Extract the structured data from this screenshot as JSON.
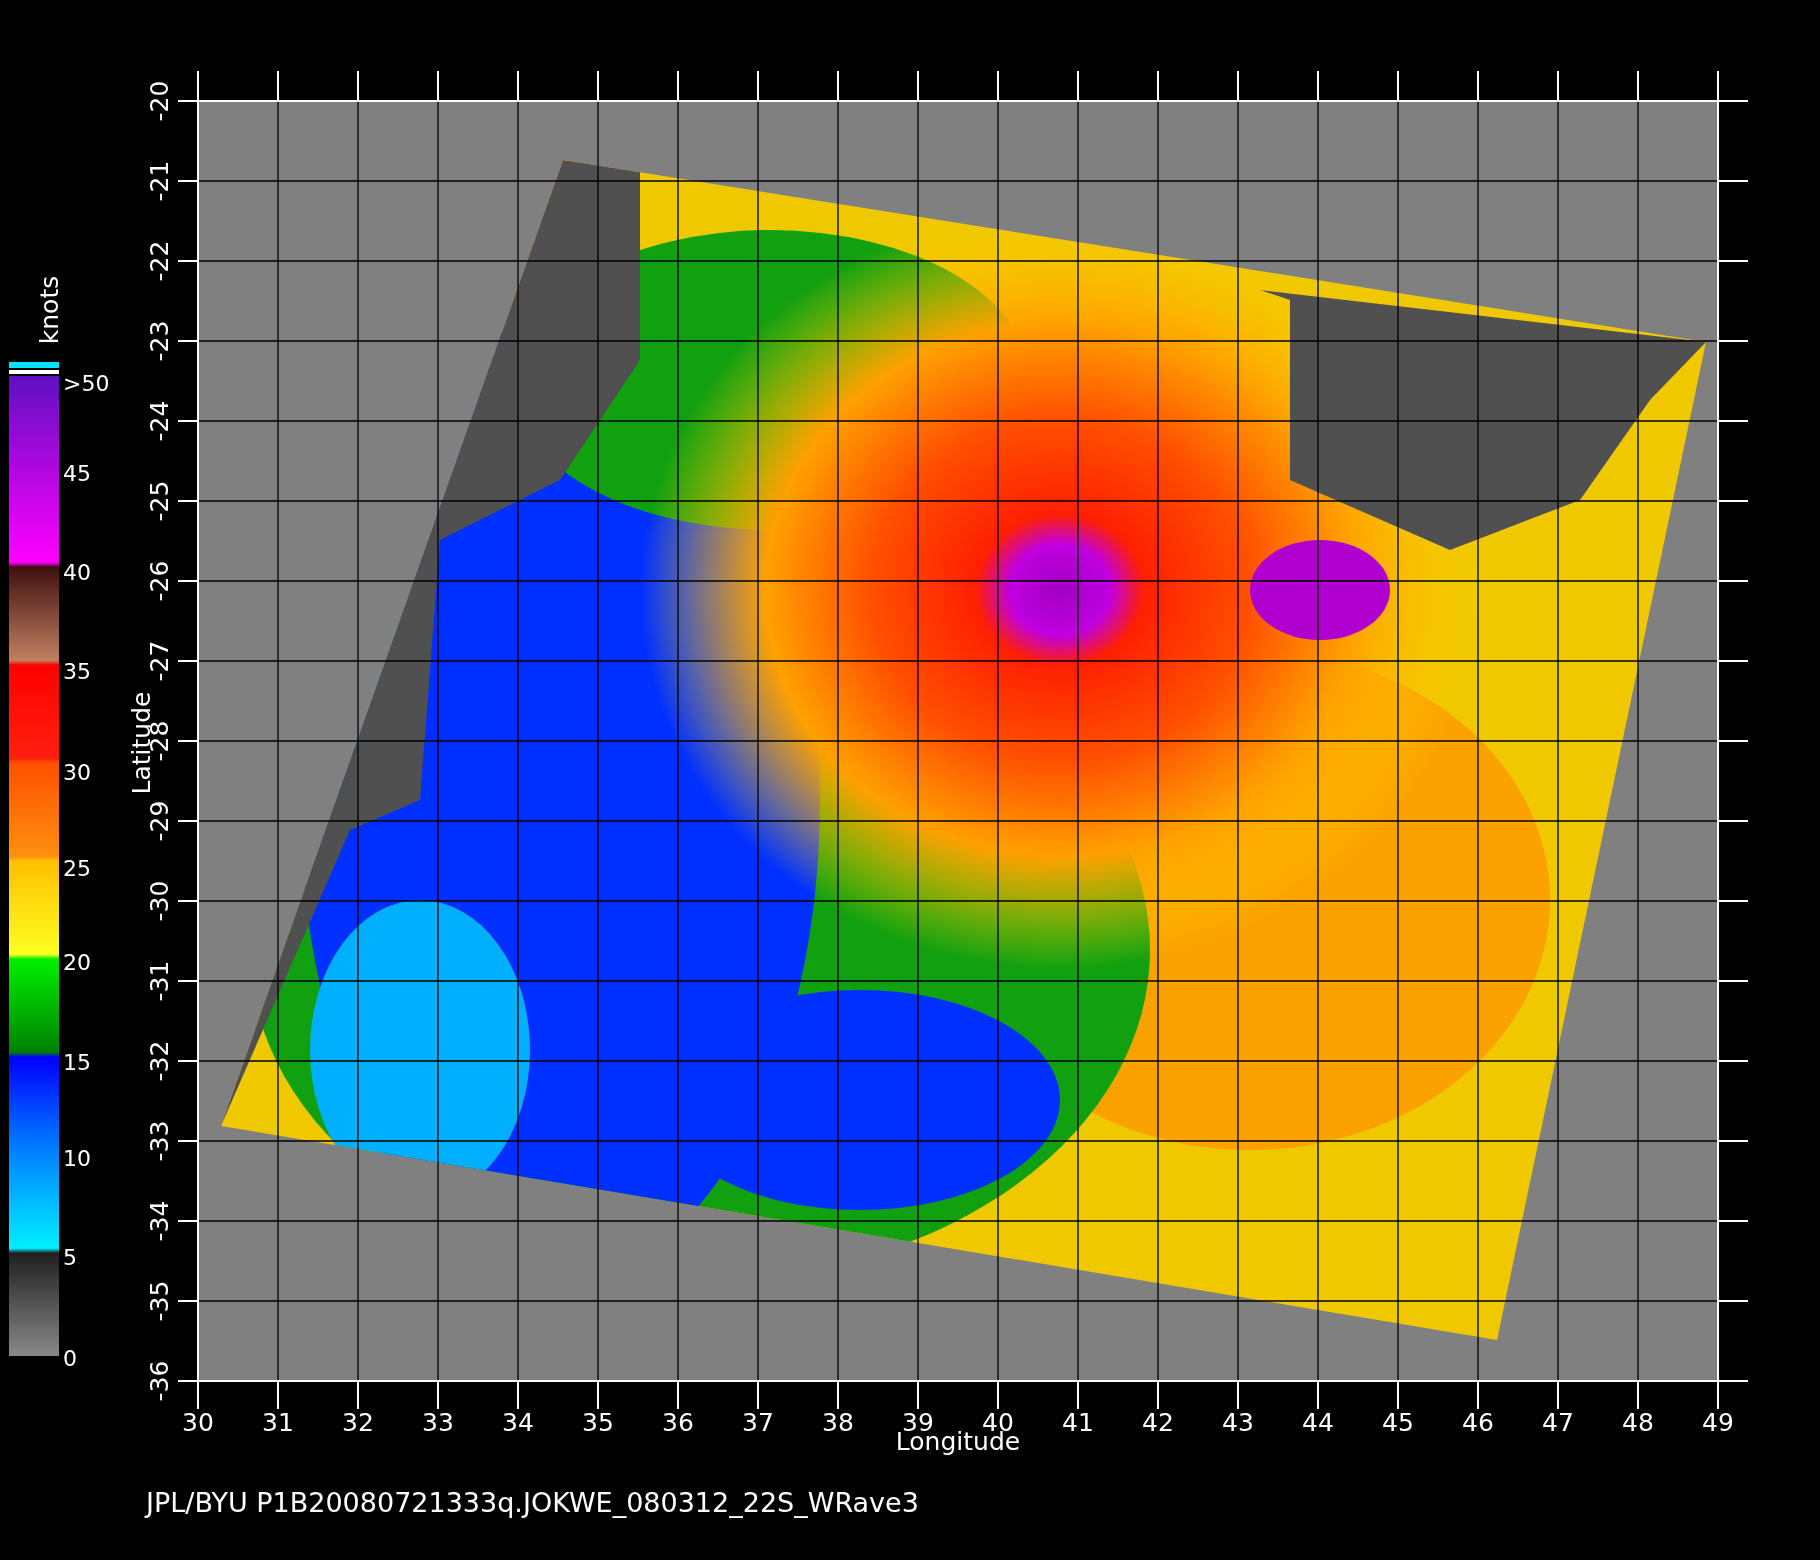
{
  "colorbar": {
    "unit": "knots",
    "labels": [
      ">50",
      "45",
      "40",
      "35",
      "30",
      "25",
      "20",
      "15",
      "10",
      "5",
      "0"
    ]
  },
  "plot": {
    "xlabel": "Longitude",
    "ylabel": "Latitude",
    "xticks": [
      "30",
      "31",
      "32",
      "33",
      "34",
      "35",
      "36",
      "37",
      "38",
      "39",
      "40",
      "41",
      "42",
      "43",
      "44",
      "45",
      "46",
      "47",
      "48",
      "49"
    ],
    "yticks": [
      "-20",
      "-21",
      "-22",
      "-23",
      "-24",
      "-25",
      "-26",
      "-27",
      "-28",
      "-29",
      "-30",
      "-31",
      "-32",
      "-33",
      "-34",
      "-35",
      "-36"
    ]
  },
  "footer": "JPL/BYU  P1B20080721333q.JOKWE_080312_22S_WRave3"
}
